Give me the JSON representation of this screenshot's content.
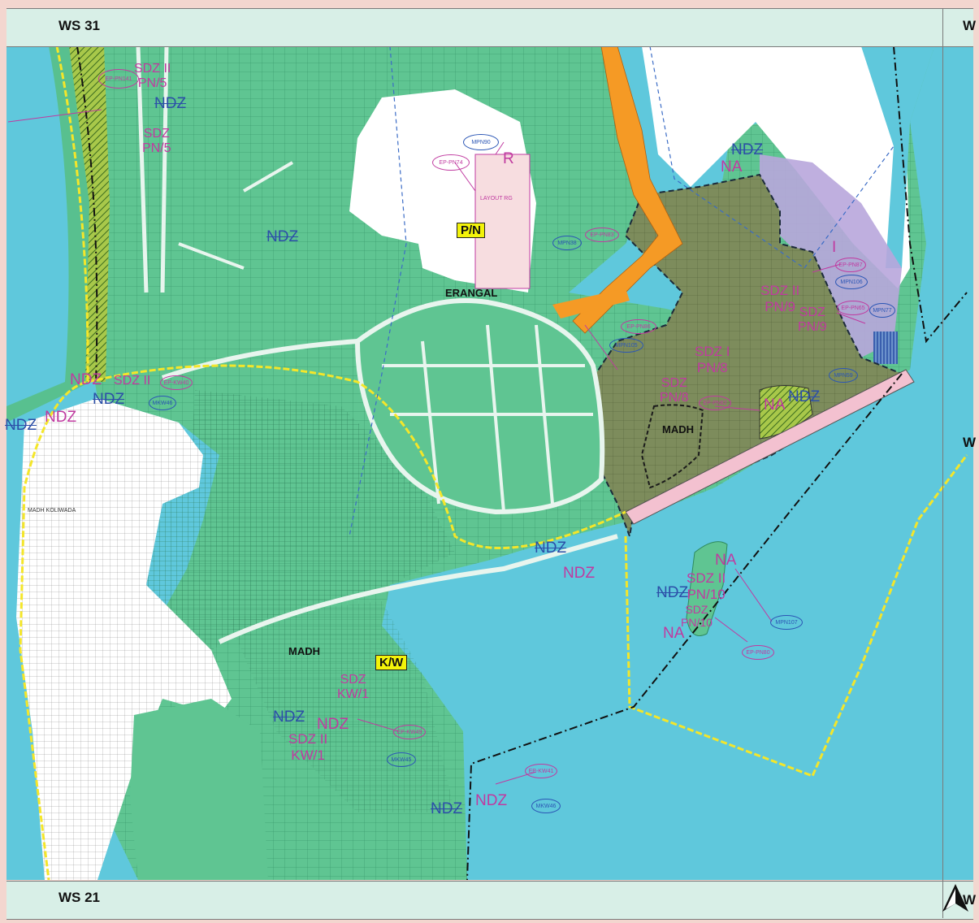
{
  "sheet_labels": {
    "top_left": "WS 31",
    "bottom_left": "WS 21",
    "top_right": "W",
    "right_mid": "W",
    "bottom_right": "W"
  },
  "zones": {
    "pn": "P/N",
    "kw": "K/W"
  },
  "places": {
    "erangal": "ERANGAL",
    "madh_center": "MADH",
    "madh_south": "MADH",
    "madh_koliwada": "MADH KOLIWADA"
  },
  "labels": {
    "ndz": "NDZ",
    "na": "NA",
    "r": "R",
    "i": "I",
    "sdz2_pn5": [
      "SDZ II",
      "PN/5"
    ],
    "sdz_pn5": [
      "SDZ",
      "PN/5"
    ],
    "sdz2_pn9": [
      "SDZ II",
      "PN/9"
    ],
    "sdz_pn9": [
      "SDZ",
      "PN/9"
    ],
    "sdz1_pn8": [
      "SDZ I",
      "PN/8"
    ],
    "sdz_pn8": [
      "SDZ",
      "PN/8"
    ],
    "sdz2_pn10": [
      "SDZ II",
      "PN/10"
    ],
    "sdz_pn10": [
      "SDZ",
      "PN/10"
    ],
    "sdz_kw1": [
      "SDZ",
      "KW/1"
    ],
    "sdz2_kw1": [
      "SDZ II",
      "KW/1"
    ],
    "sdz2_short": "SDZ II",
    "layout_rg": "LAYOUT RG"
  },
  "references": {
    "mpn90": "MPN90",
    "ep_pn74": "EP-PN74",
    "mpn38": "MPN38",
    "ep_pn83": "EP-PN83",
    "ep_pn86": "EP-PN86",
    "mpn105": "MPN105",
    "ep_pn87": "EP-PN87",
    "mpn106": "MPN106",
    "ep_pn65": "EP-PN65",
    "mpn77": "MPN77",
    "mpn59": "MPN59",
    "ep_pn82": "EP-PN82",
    "mpn107": "MPN107",
    "ep_pn80": "EP-PN80",
    "ep_kw40": "EP-KW40",
    "mkw46": "MKW46",
    "ep_kw49": "EP-KW49",
    "mkw45": "MKW45",
    "ep_kw41": "EP-KW41",
    "mkw46b": "MKW46",
    "ep_pn141": "EP-PN141"
  },
  "colors": {
    "water": "#5fc8dc",
    "land_green": "#5fc592",
    "dev_olive": "#7d8c5c",
    "orange_road": "#f59a25",
    "lavender": "#b8a6dc",
    "pink_zone": "#f7dde0",
    "boundary_yellow": "#f4e62a",
    "hatched": "#a8c84a"
  },
  "north_arrow_icon": "north-arrow-icon"
}
